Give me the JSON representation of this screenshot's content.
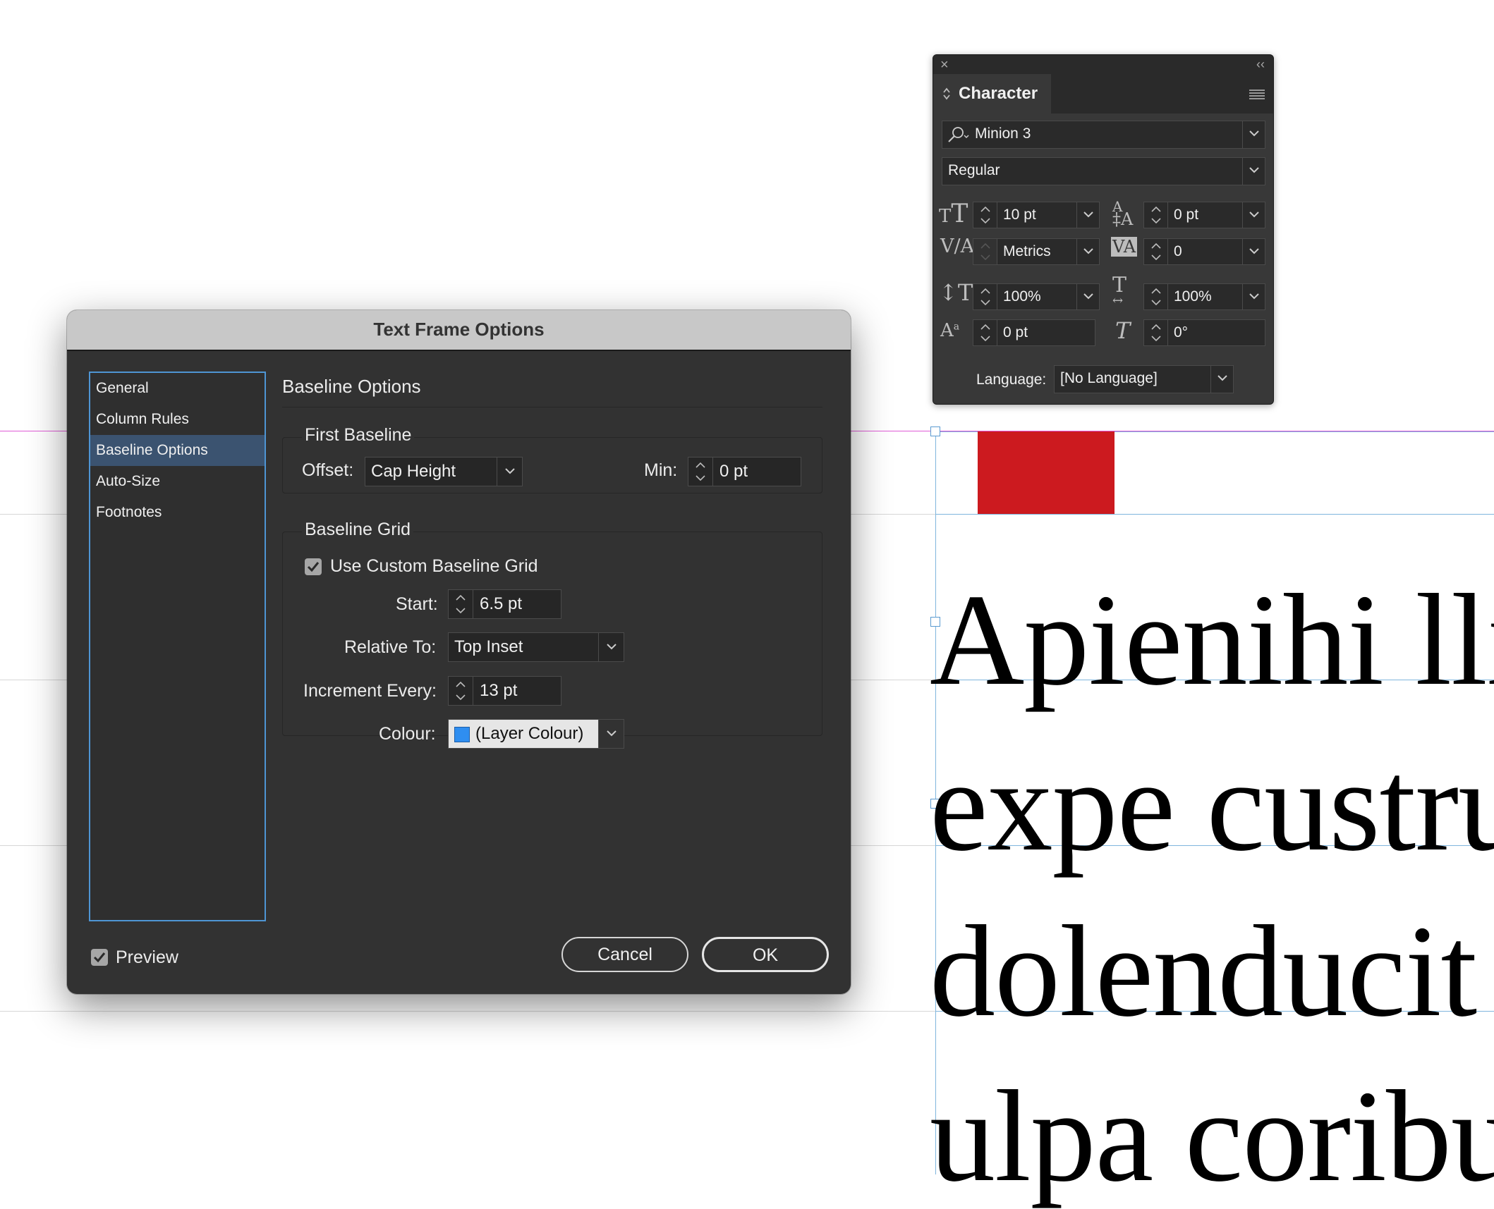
{
  "dialog": {
    "title": "Text Frame Options",
    "nav_items": [
      "General",
      "Column Rules",
      "Baseline Options",
      "Auto-Size",
      "Footnotes"
    ],
    "active_nav": "Baseline Options",
    "panel_title": "Baseline Options",
    "first_baseline": {
      "title": "First Baseline",
      "offset_label": "Offset:",
      "offset_value": "Cap Height",
      "min_label": "Min:",
      "min_value": "0 pt"
    },
    "baseline_grid": {
      "title": "Baseline Grid",
      "use_custom_label": "Use Custom Baseline Grid",
      "use_custom_checked": true,
      "start_label": "Start:",
      "start_value": "6.5 pt",
      "relative_label": "Relative To:",
      "relative_value": "Top Inset",
      "increment_label": "Increment Every:",
      "increment_value": "13 pt",
      "colour_label": "Colour:",
      "colour_value": "(Layer Colour)",
      "colour_swatch": "#2f8ef0"
    },
    "preview_label": "Preview",
    "preview_checked": true,
    "cancel_label": "Cancel",
    "ok_label": "OK"
  },
  "character_panel": {
    "title": "Character",
    "font_family": "Minion 3",
    "font_style": "Regular",
    "font_size": "10 pt",
    "leading": "0 pt",
    "kerning": "Metrics",
    "tracking": "0",
    "vertical_scale": "100%",
    "horizontal_scale": "100%",
    "baseline_shift": "0 pt",
    "skew": "0°",
    "language_label": "Language:",
    "language_value": "[No Language]",
    "icons": [
      "font-size-icon",
      "leading-icon",
      "kerning-icon",
      "tracking-icon",
      "vertical-scale-icon",
      "horizontal-scale-icon",
      "baseline-shift-icon",
      "skew-icon"
    ]
  },
  "document": {
    "lines": [
      "Apienihi lli",
      "expe custru",
      "dolenducit",
      "ulpa coribu"
    ],
    "block_color": "#cc1a1f",
    "grid_color": "#d7d7d7",
    "guide_color": "#e05ad6",
    "frame_color": "#7fb5dd"
  }
}
